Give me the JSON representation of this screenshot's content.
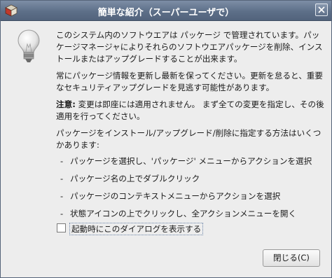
{
  "window": {
    "title": "簡単な紹介（スーパーユーザで）"
  },
  "icons": {
    "app": "package-manager-icon",
    "close": "close-icon",
    "info": "lightbulb-icon"
  },
  "content": {
    "para1": "このシステム内のソフトウエアは パッケージ で管理されています。パッケージマネージャによりそれらのソフトウエアパッケージを削除、インストールまたはアップグレードすることが出来ます。",
    "para2": "常にパッケージ情報を更新し最新を保ってください。更新を怠ると、重要なセキュリティアップグレードを見逃す可能性があります。",
    "note_label": "注意:",
    "note_text": "変更は即座には適用されません。 まず全ての変更を指定し、その後適用を行ってください。",
    "ways_intro": "パッケージをインストール/アップグレード/削除に指定する方法はいくつかあります:",
    "ways": [
      "パッケージを選択し、'パッケージ' メニューからアクションを選択",
      "パッケージ名の上でダブルクリック",
      "パッケージのコンテキストメニューからアクションを選択",
      "状態アイコンの上でクリックし、全アクションメニューを開く"
    ]
  },
  "checkbox": {
    "label": "起動時にこのダイアログを表示する",
    "checked": false
  },
  "buttons": {
    "close_label": "閉じる(C)"
  }
}
